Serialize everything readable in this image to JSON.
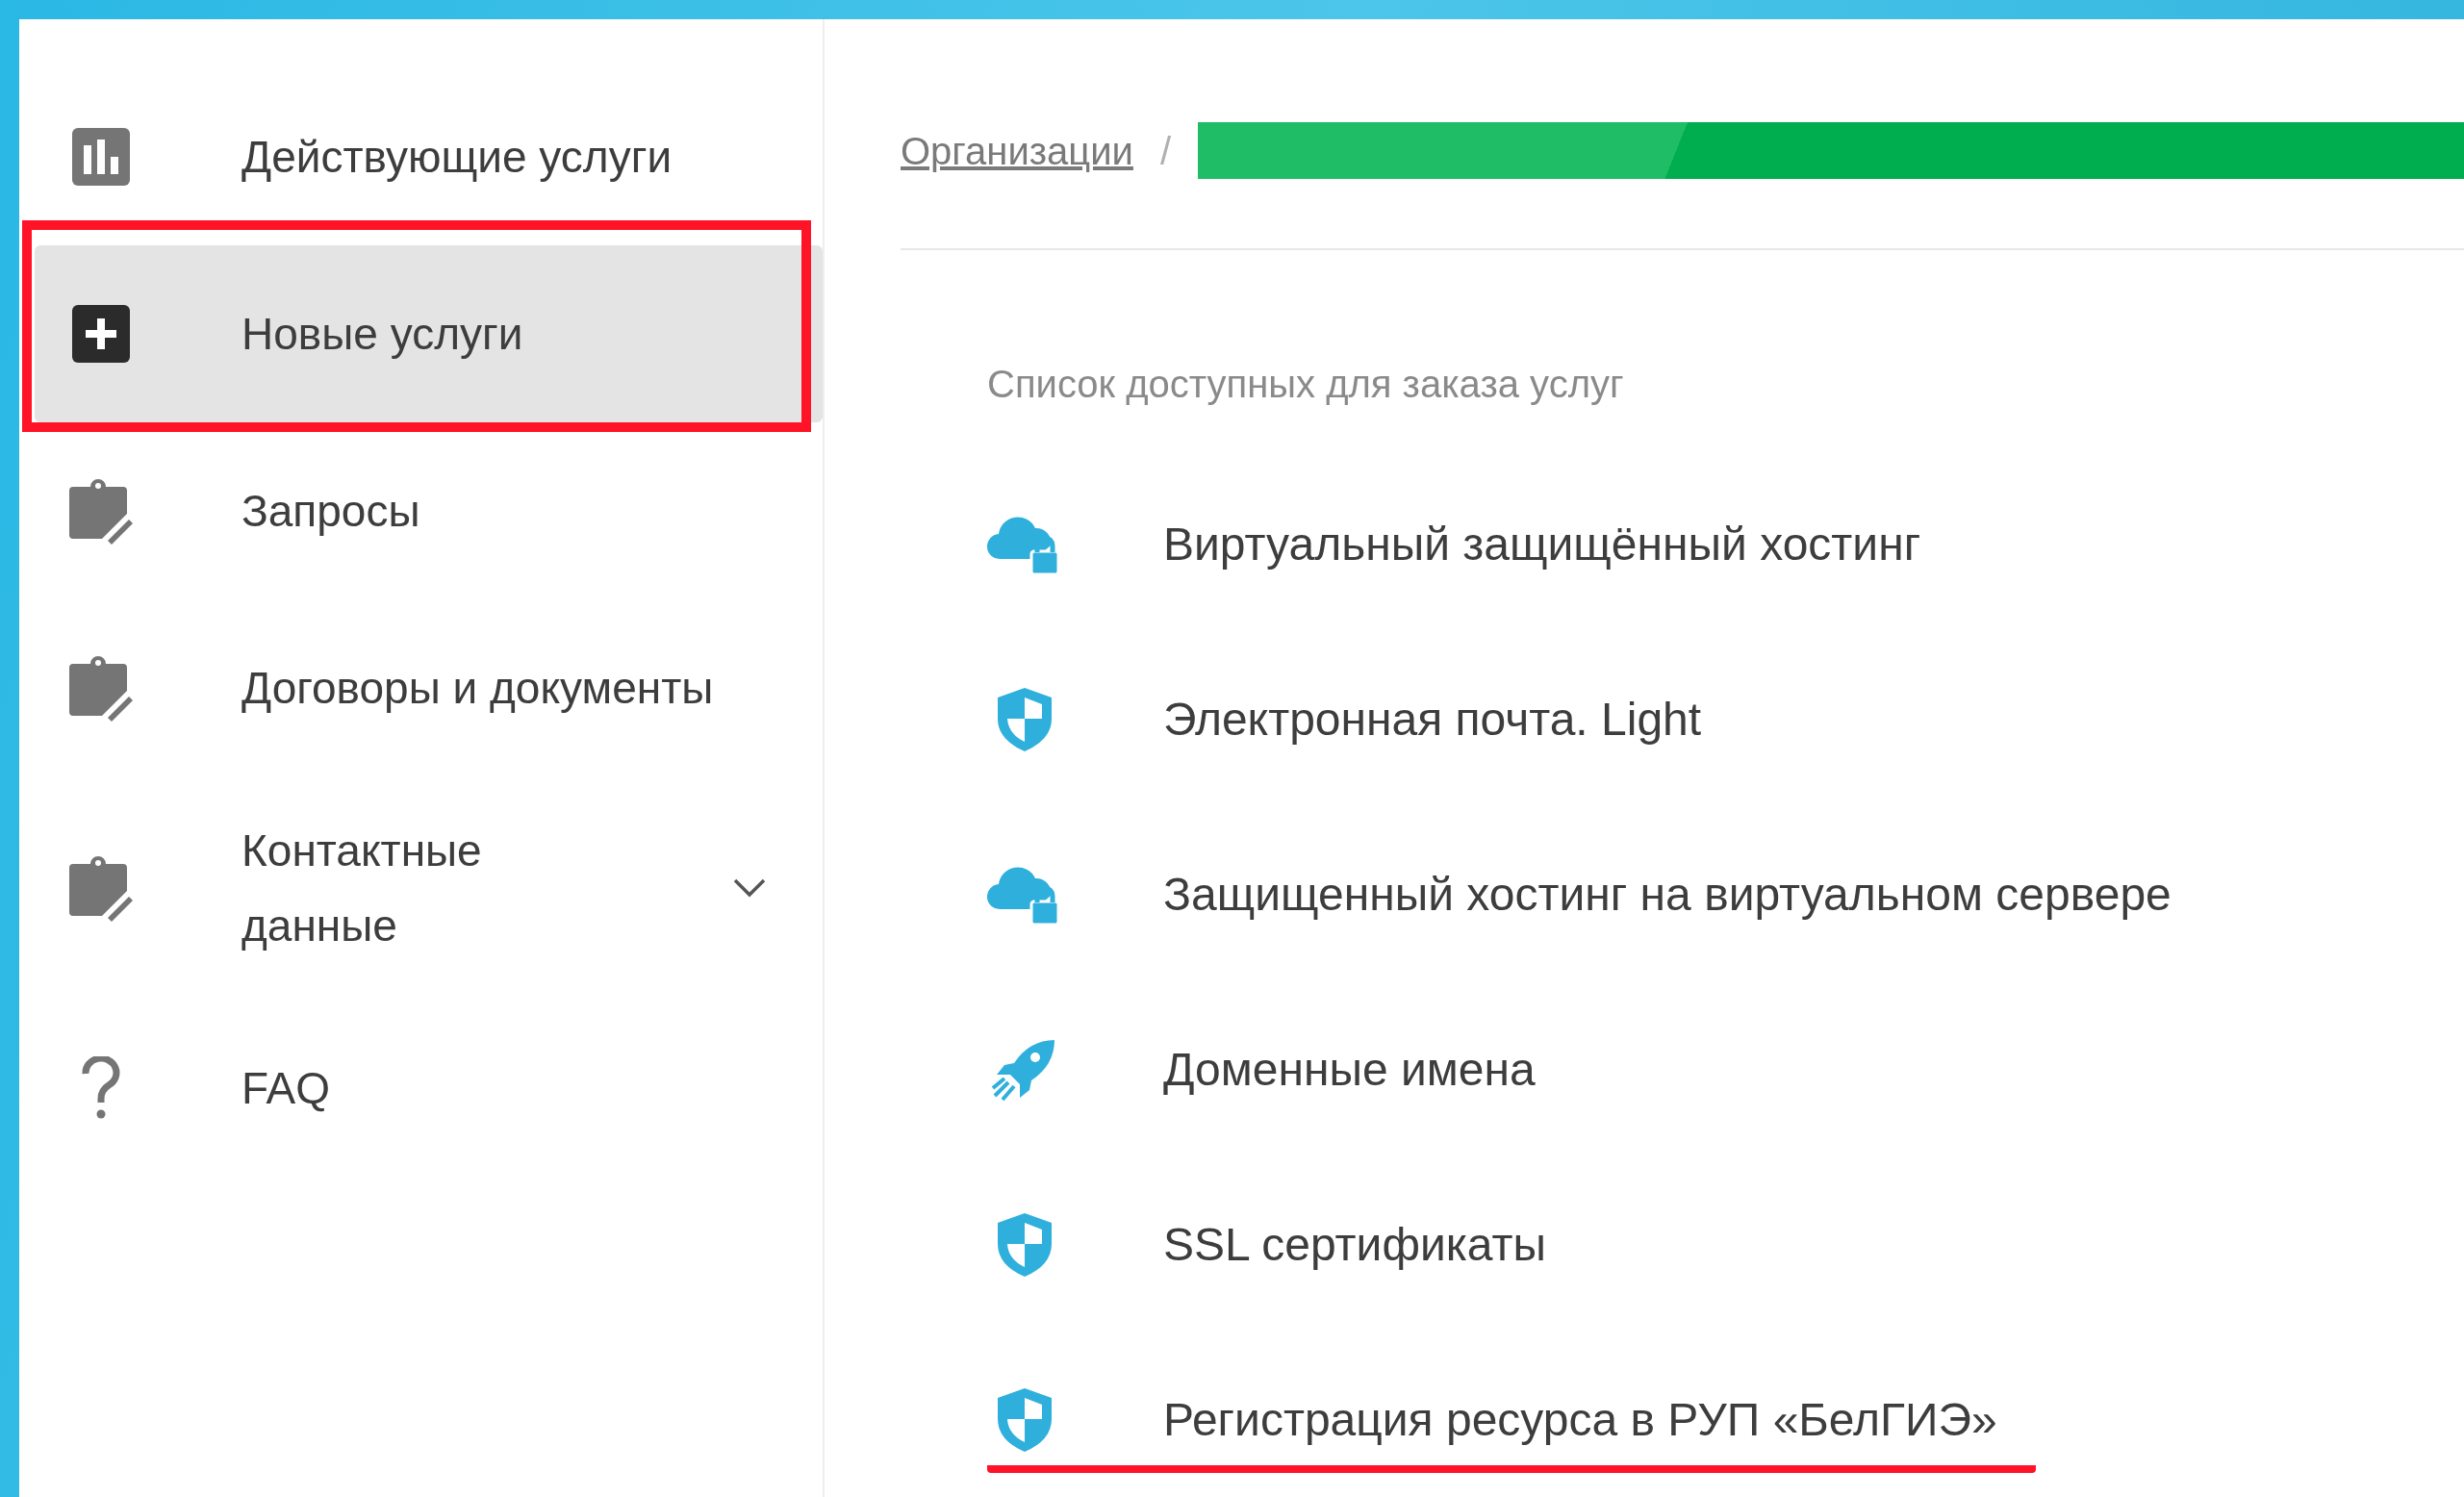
{
  "sidebar": {
    "items": [
      {
        "kind": "chart",
        "label": "Действующие услуги",
        "selected": false,
        "outlined": false
      },
      {
        "kind": "add",
        "label": "Новые услуги",
        "selected": true,
        "outlined": true
      },
      {
        "kind": "clipboard",
        "label": "Запросы",
        "selected": false,
        "outlined": false
      },
      {
        "kind": "clipboard",
        "label": "Договоры и документы",
        "selected": false,
        "outlined": false
      },
      {
        "kind": "clipboard",
        "label": "Контактные данные",
        "selected": false,
        "outlined": false,
        "expanded": false
      },
      {
        "kind": "help",
        "label": "FAQ",
        "selected": false,
        "outlined": false
      }
    ]
  },
  "breadcrumb": {
    "link": "Организации",
    "separator": "/"
  },
  "services": {
    "heading": "Список доступных для заказа услуг",
    "items": [
      {
        "kind": "cloud-lock",
        "label": "Виртуальный защищённый хостинг",
        "underlined": false
      },
      {
        "kind": "shield",
        "label": "Электронная почта. Light",
        "underlined": false
      },
      {
        "kind": "cloud-lock",
        "label": "Защищенный хостинг на виртуальном сервере",
        "underlined": false
      },
      {
        "kind": "rocket",
        "label": "Доменные имена",
        "underlined": false
      },
      {
        "kind": "shield",
        "label": "SSL сертификаты",
        "underlined": false
      },
      {
        "kind": "shield",
        "label": "Регистрация ресурса в РУП «БелГИЭ»",
        "underlined": true
      }
    ]
  }
}
